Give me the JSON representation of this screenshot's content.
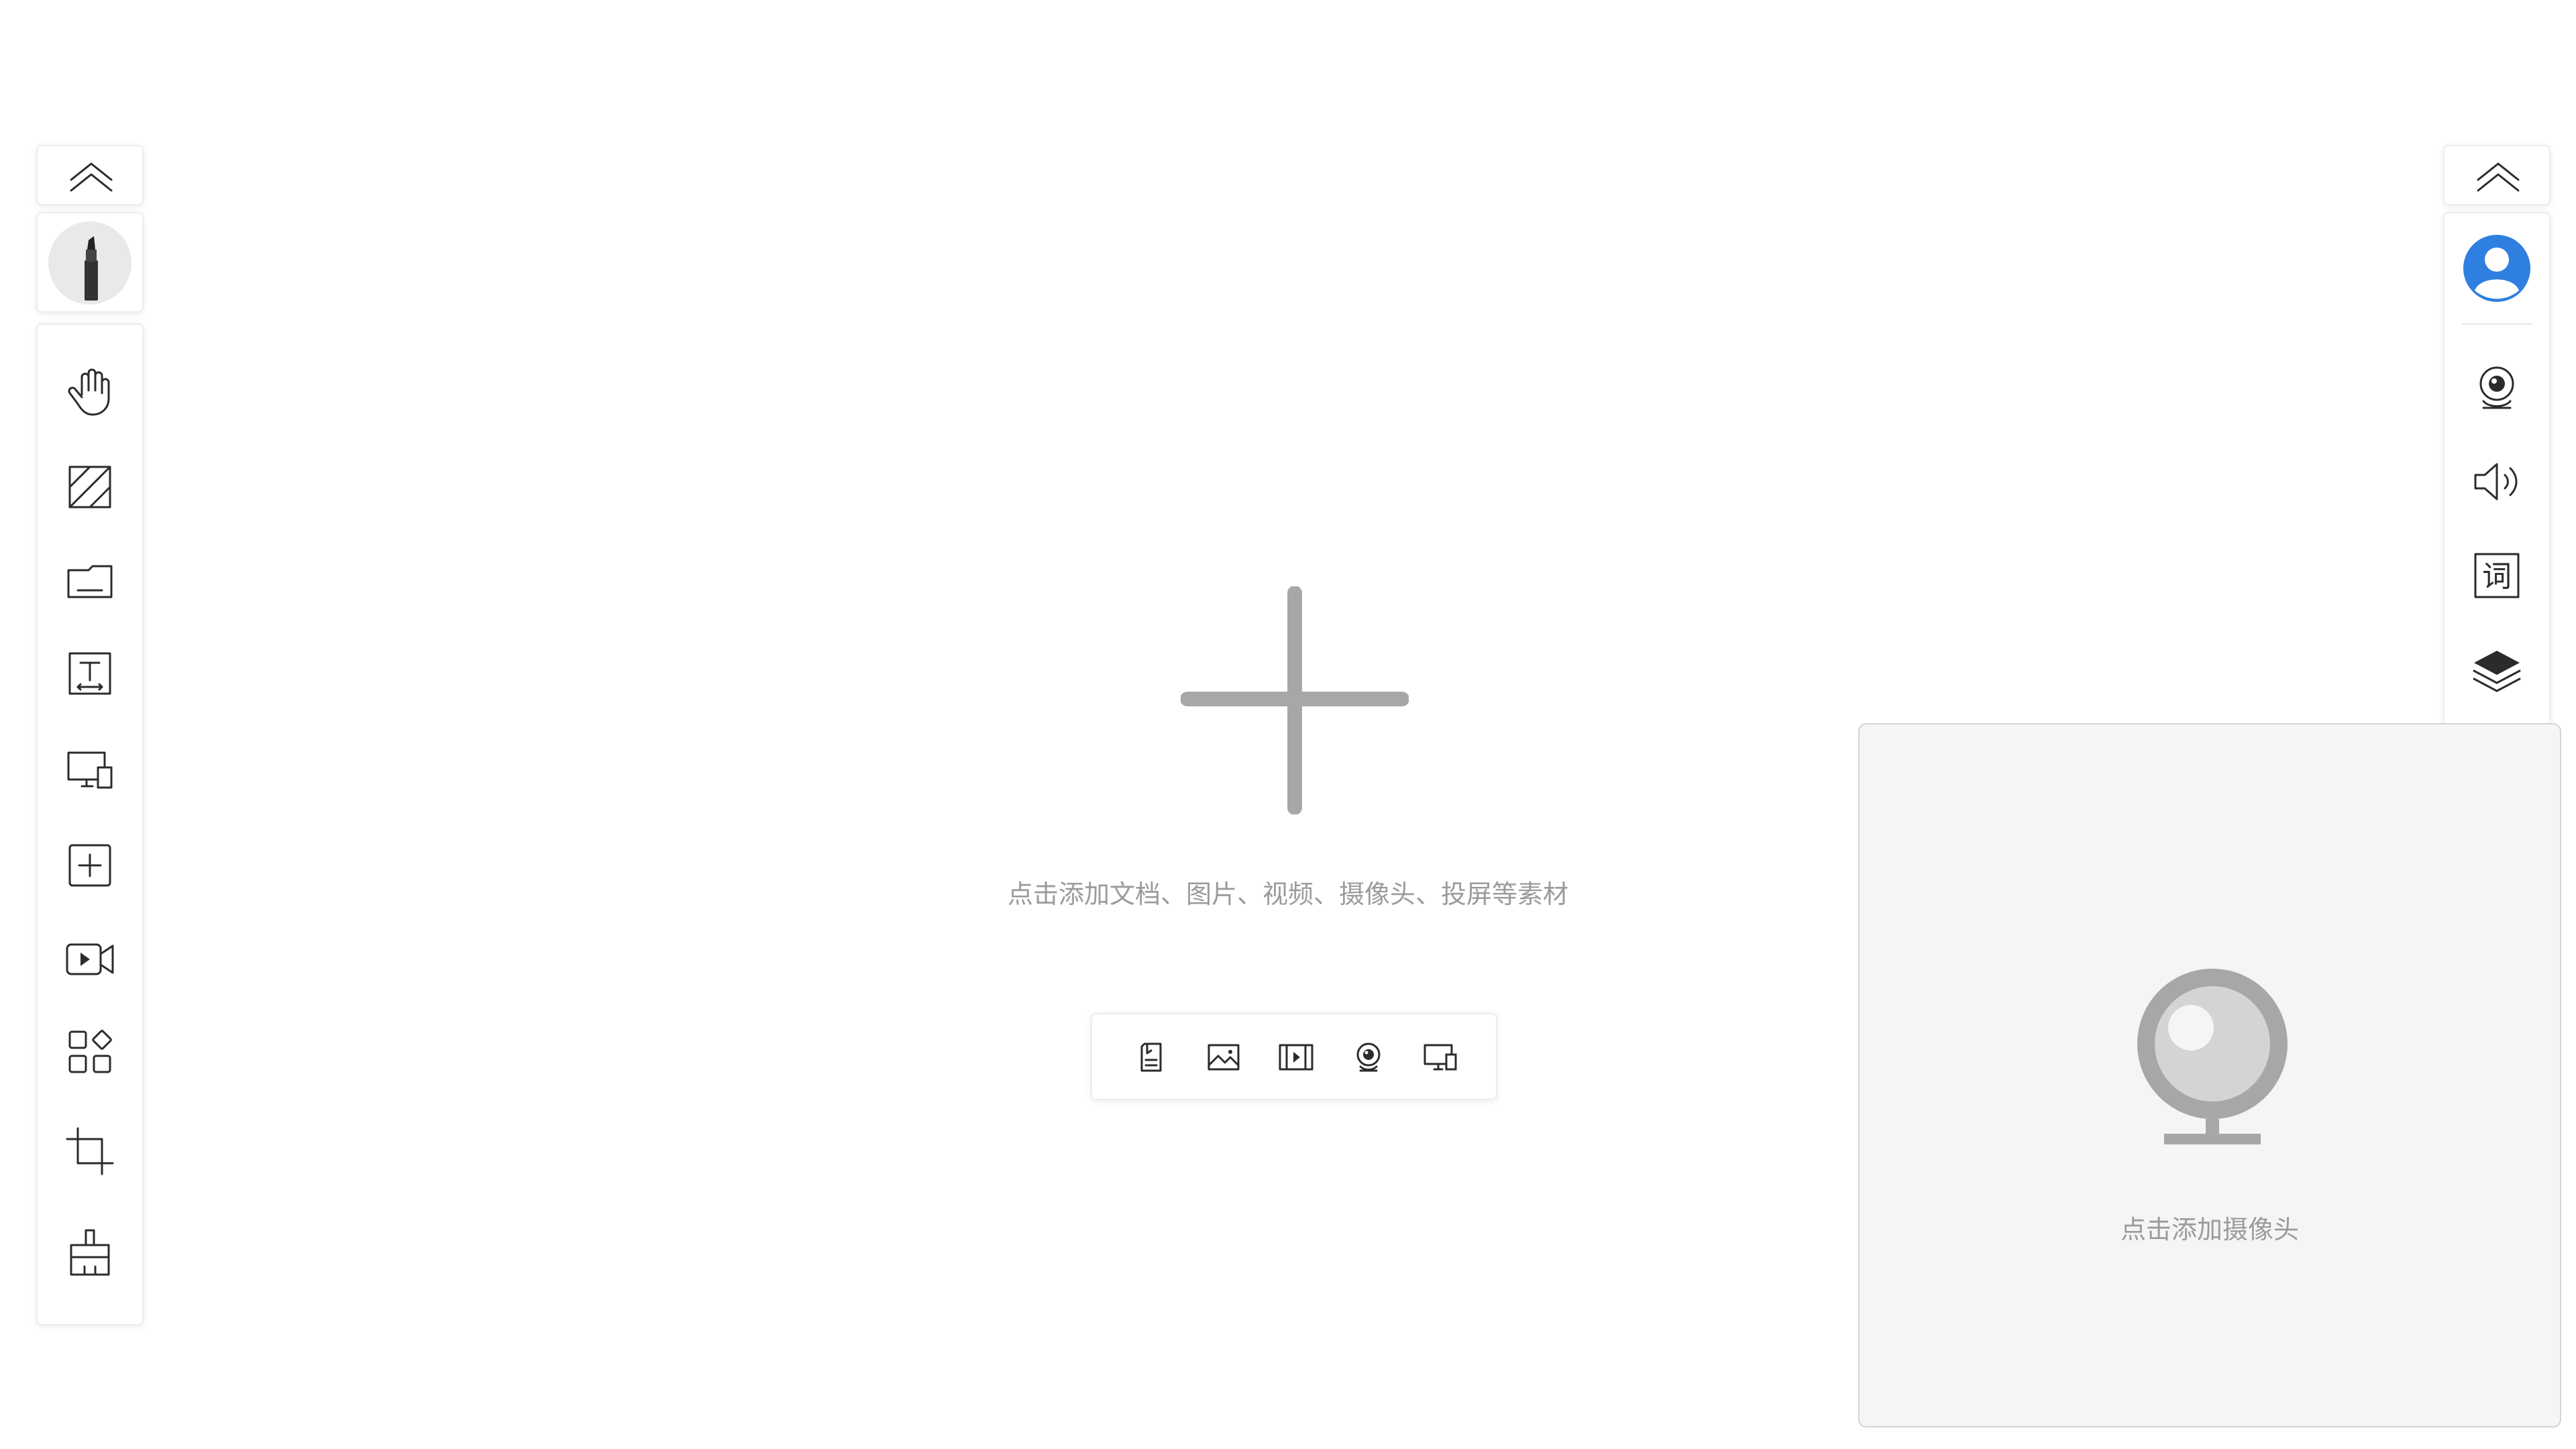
{
  "left_toolbar": {
    "collapse_icon": "chevron-up-double-icon",
    "pen_icon": "marker-pen-icon",
    "tools": [
      {
        "name": "hand-tool",
        "icon": "hand-icon"
      },
      {
        "name": "eraser-tool",
        "icon": "hatched-square-icon"
      },
      {
        "name": "folder-tool",
        "icon": "folder-icon"
      },
      {
        "name": "text-tool",
        "icon": "text-box-icon"
      },
      {
        "name": "screen-share-tool",
        "icon": "monitor-device-icon"
      },
      {
        "name": "add-tool",
        "icon": "plus-square-icon"
      },
      {
        "name": "video-tool",
        "icon": "video-camera-icon"
      },
      {
        "name": "apps-tool",
        "icon": "apps-grid-icon"
      },
      {
        "name": "crop-tool",
        "icon": "crop-icon"
      },
      {
        "name": "clean-tool",
        "icon": "broom-icon"
      }
    ]
  },
  "right_toolbar": {
    "collapse_icon": "chevron-up-double-icon",
    "tools": [
      {
        "name": "profile",
        "icon": "user-avatar-icon",
        "color": "#2f7fe0"
      },
      {
        "name": "camera",
        "icon": "webcam-icon"
      },
      {
        "name": "speaker",
        "icon": "speaker-icon"
      },
      {
        "name": "subtitles",
        "icon": "word-box-icon",
        "glyph": "词"
      },
      {
        "name": "layers",
        "icon": "layers-icon"
      },
      {
        "name": "shrink",
        "icon": "minimize-icon"
      }
    ]
  },
  "canvas": {
    "hint": "点击添加文档、图片、视频、摄像头、投屏等素材",
    "quick_add": [
      {
        "name": "add-document",
        "icon": "document-icon"
      },
      {
        "name": "add-image",
        "icon": "image-icon"
      },
      {
        "name": "add-video",
        "icon": "film-icon"
      },
      {
        "name": "add-camera",
        "icon": "webcam-icon"
      },
      {
        "name": "add-screencast",
        "icon": "screencast-icon"
      }
    ]
  },
  "camera_card": {
    "hint": "点击添加摄像头"
  },
  "colors": {
    "accent": "#2f7fe0",
    "hint_text": "#9b9b9b",
    "placeholder_gray": "#a7a7a7"
  }
}
